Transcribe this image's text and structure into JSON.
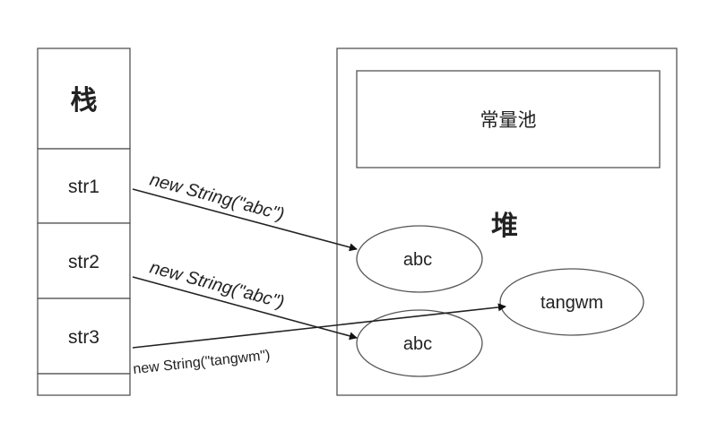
{
  "stack": {
    "title": "栈",
    "cells": [
      "str1",
      "str2",
      "str3"
    ]
  },
  "heap": {
    "title": "堆",
    "constant_pool_label": "常量池",
    "objects": [
      "abc",
      "abc",
      "tangwm"
    ]
  },
  "edges": [
    {
      "from": "str1",
      "to": "abc",
      "label": "new String(\"abc\")"
    },
    {
      "from": "str2",
      "to": "abc",
      "label": "new String(\"abc\")"
    },
    {
      "from": "str3",
      "to": "tangwm",
      "label": "new String(\"tangwm\")"
    }
  ],
  "colors": {
    "stroke": "#555555",
    "text": "#222222",
    "background": "#ffffff"
  }
}
